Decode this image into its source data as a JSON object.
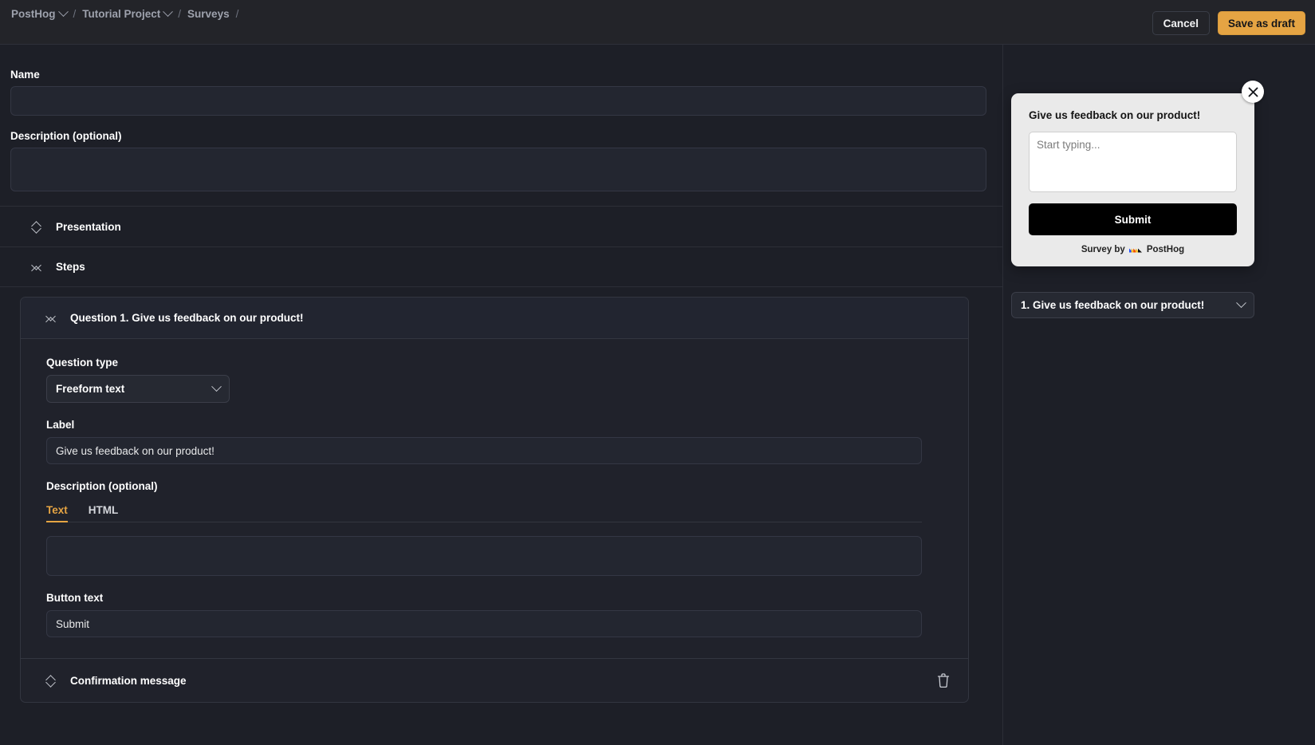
{
  "topbar": {
    "breadcrumbs": [
      {
        "label": "PostHog",
        "has_chevron": true,
        "icon": "chevron-down-icon"
      },
      {
        "label": "Tutorial Project",
        "has_chevron": true,
        "icon": "chevron-down-icon"
      },
      {
        "label": "Surveys",
        "has_chevron": false,
        "icon": ""
      }
    ],
    "separator": "/",
    "cancel_label": "Cancel",
    "save_label": "Save as draft"
  },
  "form": {
    "name_label": "Name",
    "name_value": "",
    "name_placeholder": "",
    "description_label": "Description (optional)",
    "description_value": "",
    "description_placeholder": "",
    "presentation_label": "Presentation",
    "presentation_icon": "expand-collapse-icon",
    "steps_label": "Steps",
    "steps_icon": "collapse-icon"
  },
  "question": {
    "header": "Question 1. Give us feedback on our product!",
    "header_icon": "collapse-icon",
    "type_label": "Question type",
    "type_value": "Freeform text",
    "type_chevron": "chevron-down-icon",
    "label_label": "Label",
    "label_value": "Give us feedback on our product!",
    "desc_label": "Description (optional)",
    "tabs": [
      {
        "label": "Text",
        "active": true
      },
      {
        "label": "HTML",
        "active": false
      }
    ],
    "desc_value": "",
    "button_text_label": "Button text",
    "button_text_value": "Submit",
    "confirmation_label": "Confirmation message",
    "confirmation_icon": "expand-collapse-icon",
    "delete_icon": "trash-icon"
  },
  "preview": {
    "close_icon": "close-icon",
    "question_text": "Give us feedback on our product!",
    "input_value": "",
    "input_placeholder": "Start typing...",
    "submit_label": "Submit",
    "footer_prefix": "Survey by",
    "footer_brand": "PostHog",
    "footer_logo_icon": "posthog-logo-icon",
    "selector_value": "1. Give us feedback on our product!",
    "selector_chevron": "chevron-down-icon"
  },
  "colors": {
    "accent": "#e5a443",
    "background": "#1d1f27",
    "panel": "#232429",
    "preview_bg": "#eaeaea",
    "submit_bg": "#000000"
  }
}
